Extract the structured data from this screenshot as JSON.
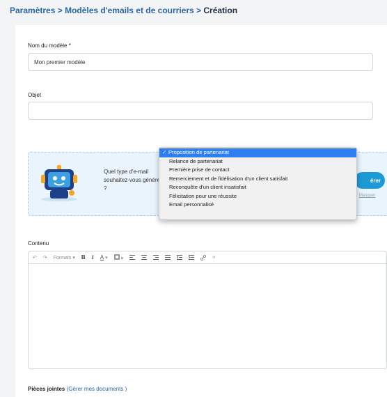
{
  "breadcrumb": {
    "level1": "Paramètres",
    "sep1": " > ",
    "level2": "Modèles d'emails et de courriers",
    "sep2": " > ",
    "current": "Création"
  },
  "form": {
    "name_label": "Nom du modèle *",
    "name_value": "Mon premier modèle",
    "subject_label": "Objet",
    "subject_value": ""
  },
  "ai": {
    "question": "Quel type d'e-mail souhaitez-vous générer ?",
    "generate_label": "érer",
    "hide_label": "Masquer"
  },
  "dropdown": {
    "check": "✓",
    "options": [
      "Proposition de partenariat",
      "Relance de partenariat",
      "Première prise de contact",
      "Remerciement et de fidélisation d'un client satisfait",
      "Reconquête d'un client insatisfait",
      "Félicitation pour une réussite",
      "Email personnalisé"
    ],
    "selected_index": 0
  },
  "editor": {
    "label": "Contenu",
    "formats_label": "Formats",
    "bold": "B",
    "italic": "I",
    "font_color": "A",
    "body": ""
  },
  "attachments": {
    "label": "Pièces jointes ",
    "link": "(Gérer mes documents )"
  },
  "colors": {
    "accent": "#1c9ad6",
    "link": "#2a66a8",
    "selected": "#2f7ef0"
  }
}
